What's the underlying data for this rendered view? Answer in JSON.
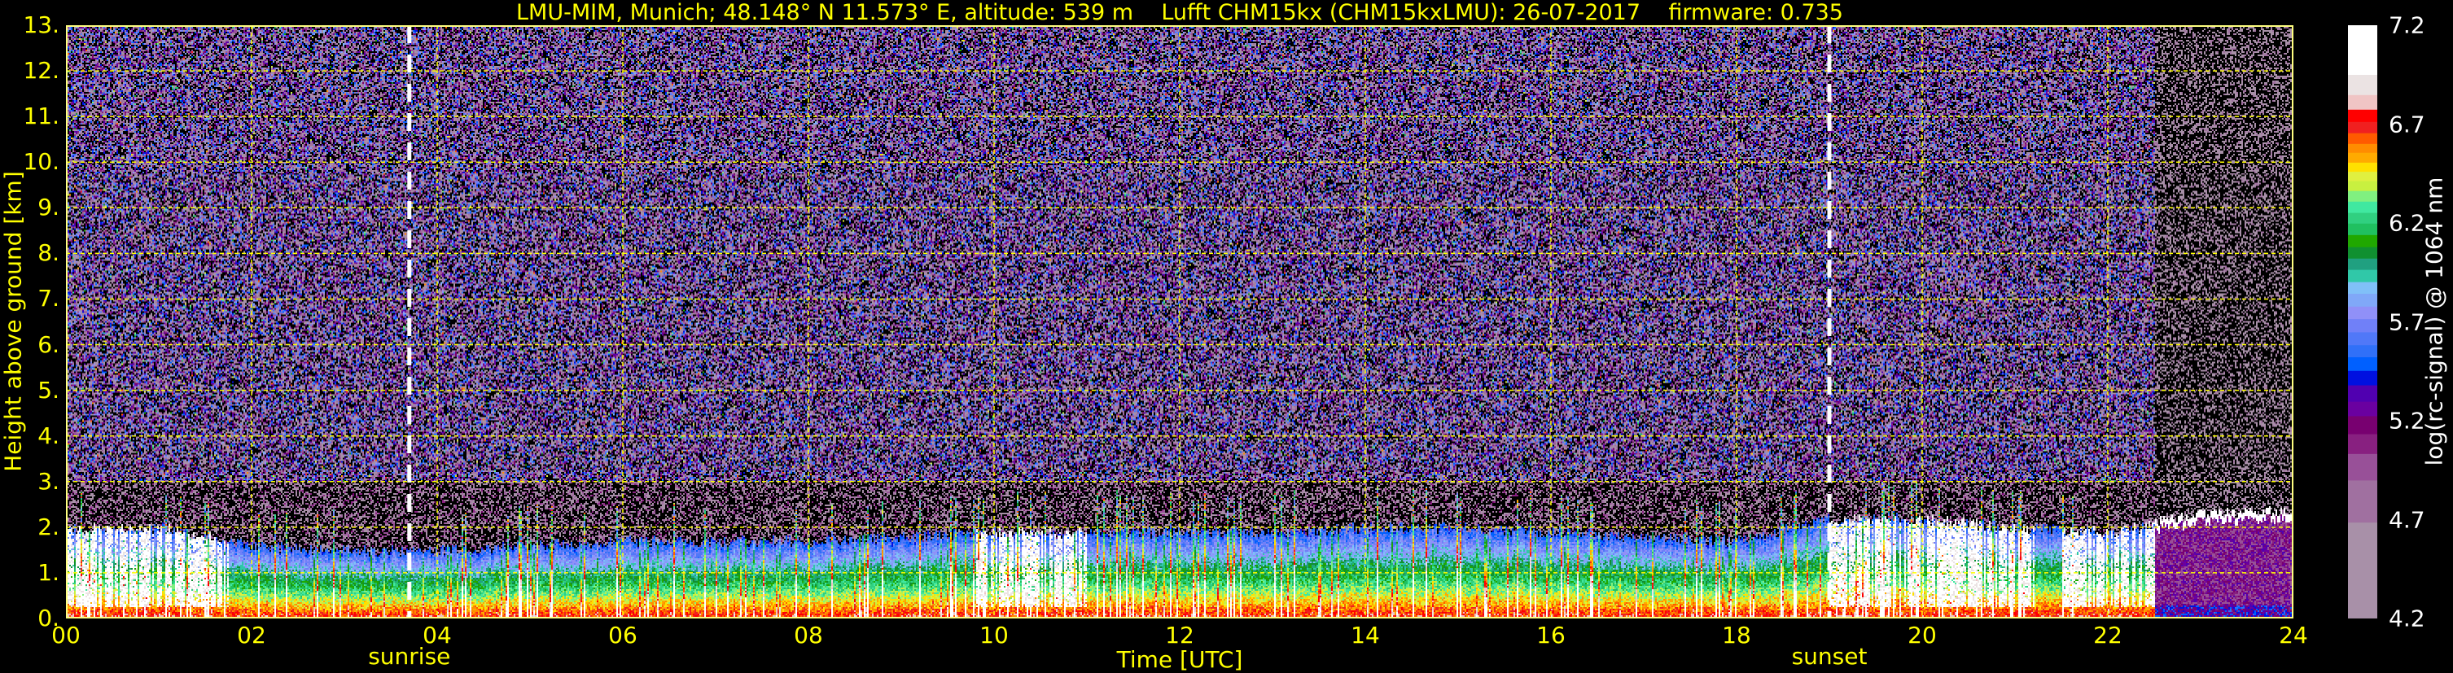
{
  "chart_data": {
    "type": "heatmap",
    "title": "LMU-MIM, Munich; 48.148° N 11.573° E, altitude: 539 m    Lufft CHM15kx (CHM15kxLMU): 26-07-2017    firmware: 0.735",
    "xlabel": "Time [UTC]",
    "ylabel": "Height above ground [km]",
    "xlim": [
      0,
      24
    ],
    "ylim": [
      0,
      13
    ],
    "xticks": [
      {
        "v": 0,
        "label": "00"
      },
      {
        "v": 2,
        "label": "02"
      },
      {
        "v": 4,
        "label": "04"
      },
      {
        "v": 6,
        "label": "06"
      },
      {
        "v": 8,
        "label": "08"
      },
      {
        "v": 10,
        "label": "10"
      },
      {
        "v": 12,
        "label": "12"
      },
      {
        "v": 14,
        "label": "14"
      },
      {
        "v": 16,
        "label": "16"
      },
      {
        "v": 18,
        "label": "18"
      },
      {
        "v": 20,
        "label": "20"
      },
      {
        "v": 22,
        "label": "22"
      },
      {
        "v": 24,
        "label": "24"
      }
    ],
    "yticks": [
      {
        "v": 0,
        "label": "0."
      },
      {
        "v": 1,
        "label": "1."
      },
      {
        "v": 2,
        "label": "2."
      },
      {
        "v": 3,
        "label": "3."
      },
      {
        "v": 4,
        "label": "4."
      },
      {
        "v": 5,
        "label": "5."
      },
      {
        "v": 6,
        "label": "6."
      },
      {
        "v": 7,
        "label": "7."
      },
      {
        "v": 8,
        "label": "8."
      },
      {
        "v": 9,
        "label": "9."
      },
      {
        "v": 10,
        "label": "10."
      },
      {
        "v": 11,
        "label": "11."
      },
      {
        "v": 12,
        "label": "12."
      },
      {
        "v": 13,
        "label": "13."
      }
    ],
    "grid": true,
    "annotations": [
      {
        "label": "sunrise",
        "hour": 3.7
      },
      {
        "label": "sunset",
        "hour": 19.0
      }
    ],
    "aerosol_layer_top_km_hourly": [
      2.0,
      2.0,
      1.6,
      1.5,
      1.5,
      1.6,
      1.7,
      1.7,
      1.7,
      1.8,
      1.9,
      1.9,
      1.9,
      1.9,
      2.0,
      2.0,
      1.9,
      1.8,
      1.7,
      2.2,
      2.2,
      2.0,
      1.9,
      2.2,
      2.3
    ],
    "cloud_periods_hours": [
      [
        0.0,
        1.8
      ],
      [
        9.8,
        11.0
      ],
      [
        19.0,
        21.2
      ],
      [
        21.5,
        22.5
      ]
    ],
    "colorbar": {
      "label": "log(rc-signal) @ 1064 nm",
      "range": [
        4.2,
        7.2
      ],
      "ticks": [
        "4.2",
        "4.7",
        "5.2",
        "5.7",
        "6.2",
        "6.7",
        "7.2"
      ],
      "levels": [
        4.2,
        4.687,
        4.9,
        5.034,
        5.134,
        5.225,
        5.298,
        5.381,
        5.454,
        5.523,
        5.584,
        5.649,
        5.716,
        5.779,
        5.844,
        5.903,
        5.965,
        6.022,
        6.08,
        6.141,
        6.199,
        6.253,
        6.31,
        6.364,
        6.414,
        6.461,
        6.507,
        6.557,
        6.602,
        6.656,
        6.713,
        6.775,
        6.849,
        6.951,
        7.2
      ],
      "colors": [
        "#a890a8",
        "#a070a0",
        "#985098",
        "#882080",
        "#780070",
        "#6a00a0",
        "#5000b0",
        "#0010e0",
        "#0060ff",
        "#3070f8",
        "#5078f8",
        "#7080f8",
        "#9090f8",
        "#80a8f8",
        "#80c0f8",
        "#30c8a8",
        "#20a080",
        "#109030",
        "#20a800",
        "#20c060",
        "#30d080",
        "#40e8a0",
        "#80f080",
        "#c8f040",
        "#e0f040",
        "#ffe000",
        "#ffaa00",
        "#ff8c00",
        "#ff5a00",
        "#f02020",
        "#ff0000",
        "#f0c4c4",
        "#ebe3e3",
        "#ffffff"
      ]
    },
    "colors": {
      "axis_text": "#ffff00",
      "grid": "#ffff00",
      "colorbar_text": "#ffffff",
      "background": "#000000"
    }
  }
}
